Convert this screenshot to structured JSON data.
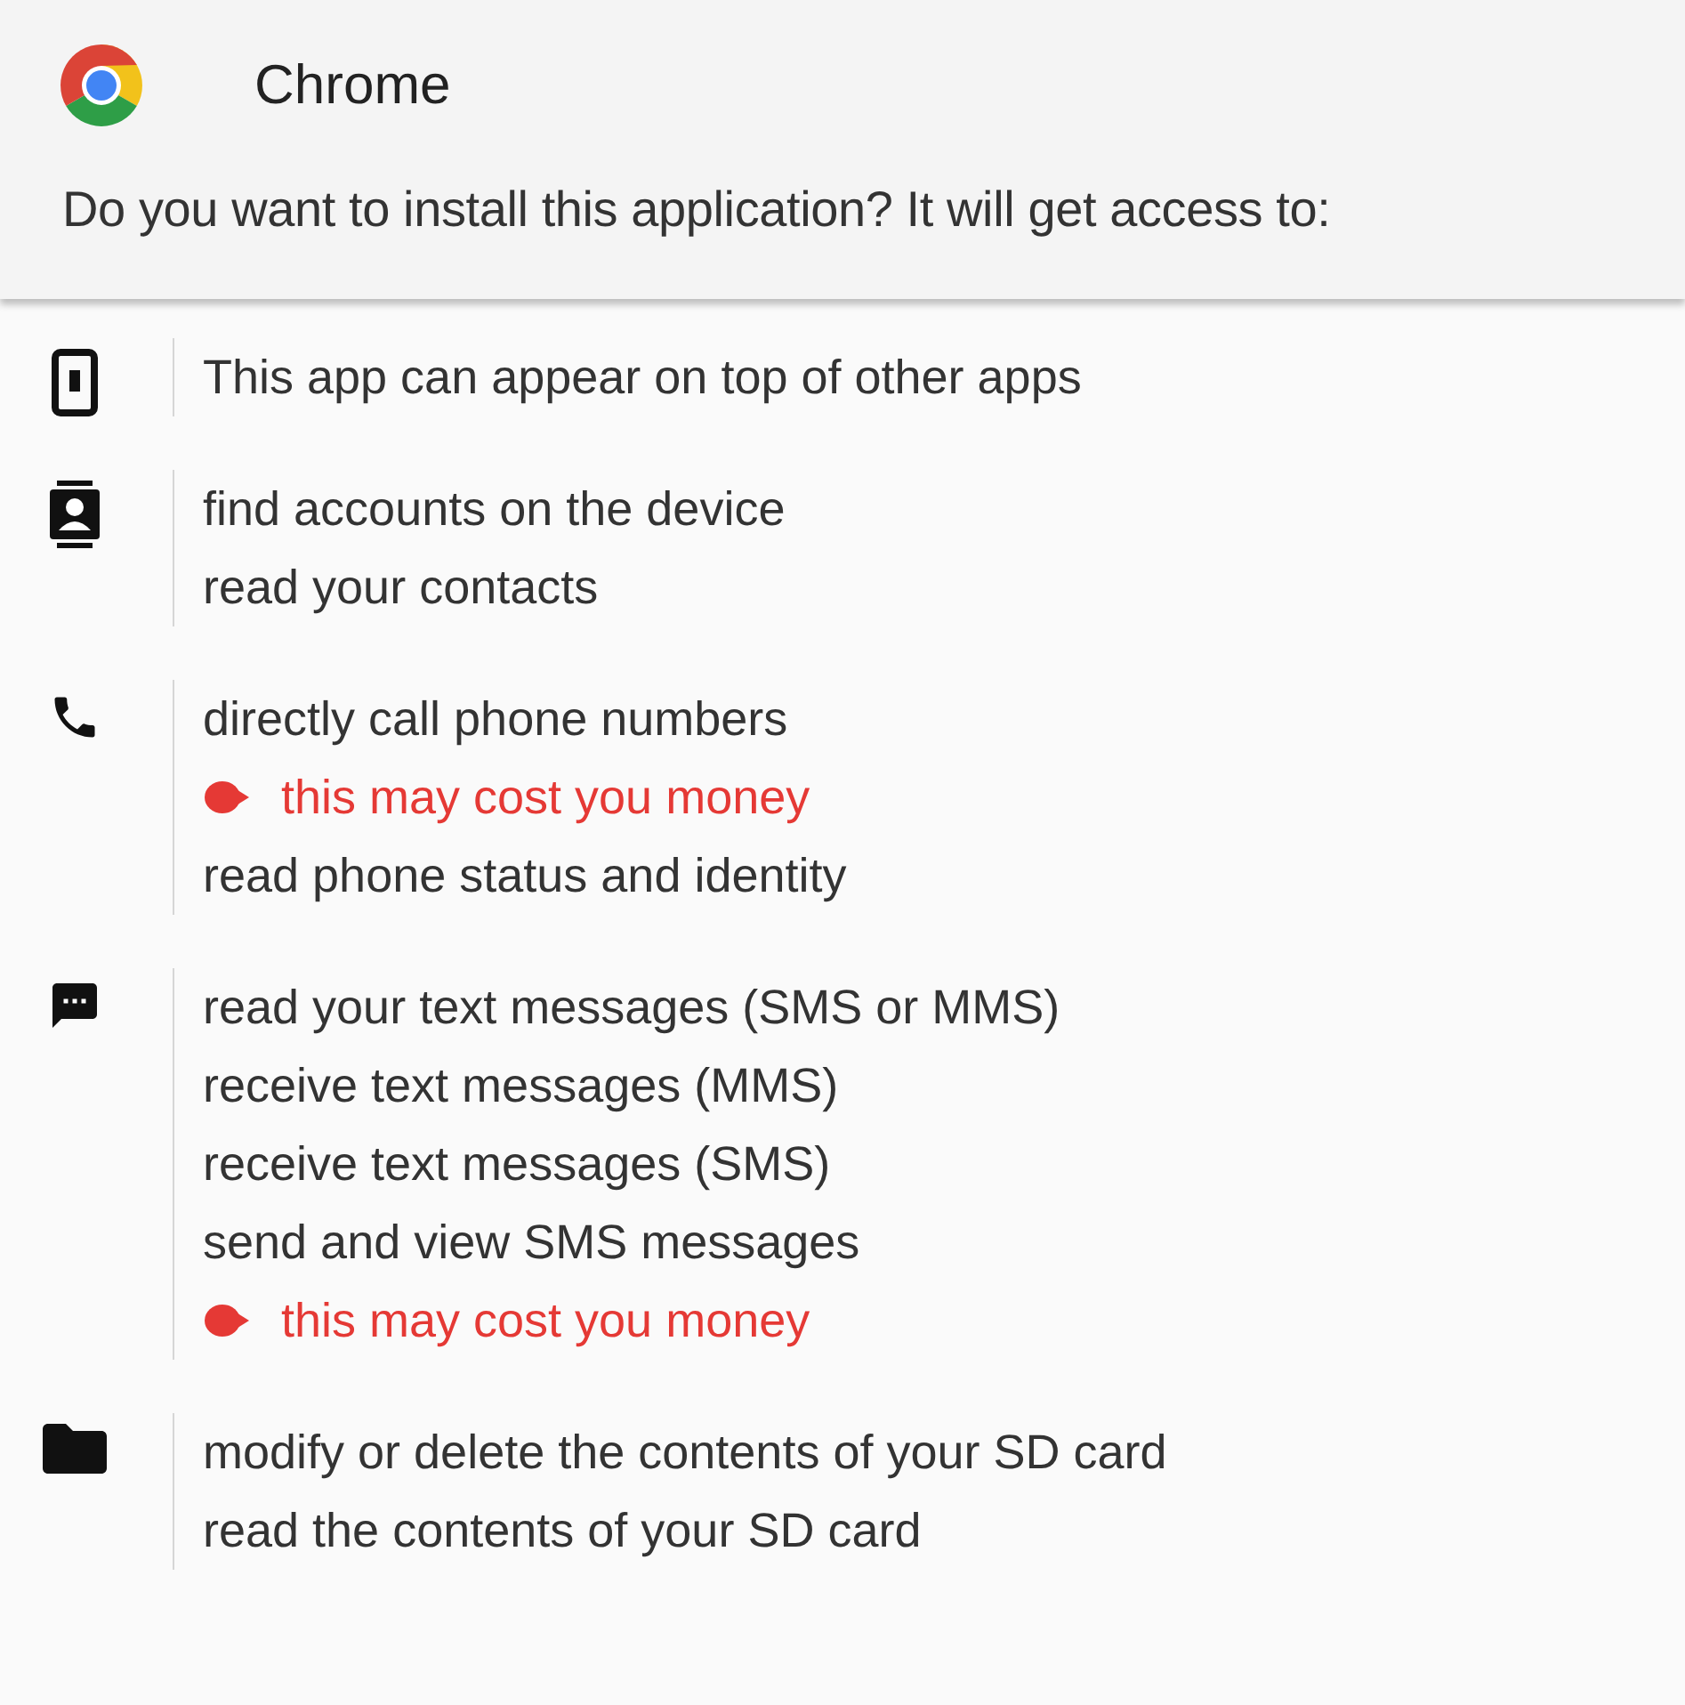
{
  "app": {
    "name": "Chrome"
  },
  "prompt": "Do you want to install this application? It will get access to:",
  "groups": [
    {
      "items": [
        {
          "kind": "permission",
          "text": "This app can appear on top of other apps"
        }
      ]
    },
    {
      "items": [
        {
          "kind": "permission",
          "text": "find accounts on the device"
        },
        {
          "kind": "permission",
          "text": "read your contacts"
        }
      ]
    },
    {
      "items": [
        {
          "kind": "permission",
          "text": "directly call phone numbers"
        },
        {
          "kind": "warning",
          "text": "this may cost you money"
        },
        {
          "kind": "permission",
          "text": "read phone status and identity"
        }
      ]
    },
    {
      "items": [
        {
          "kind": "permission",
          "text": "read your text messages (SMS or MMS)"
        },
        {
          "kind": "permission",
          "text": "receive text messages (MMS)"
        },
        {
          "kind": "permission",
          "text": "receive text messages (SMS)"
        },
        {
          "kind": "permission",
          "text": "send and view SMS messages"
        },
        {
          "kind": "warning",
          "text": "this may cost you money"
        }
      ]
    },
    {
      "items": [
        {
          "kind": "permission",
          "text": "modify or delete the contents of your SD card"
        },
        {
          "kind": "permission",
          "text": "read the contents of your SD card"
        }
      ]
    }
  ]
}
